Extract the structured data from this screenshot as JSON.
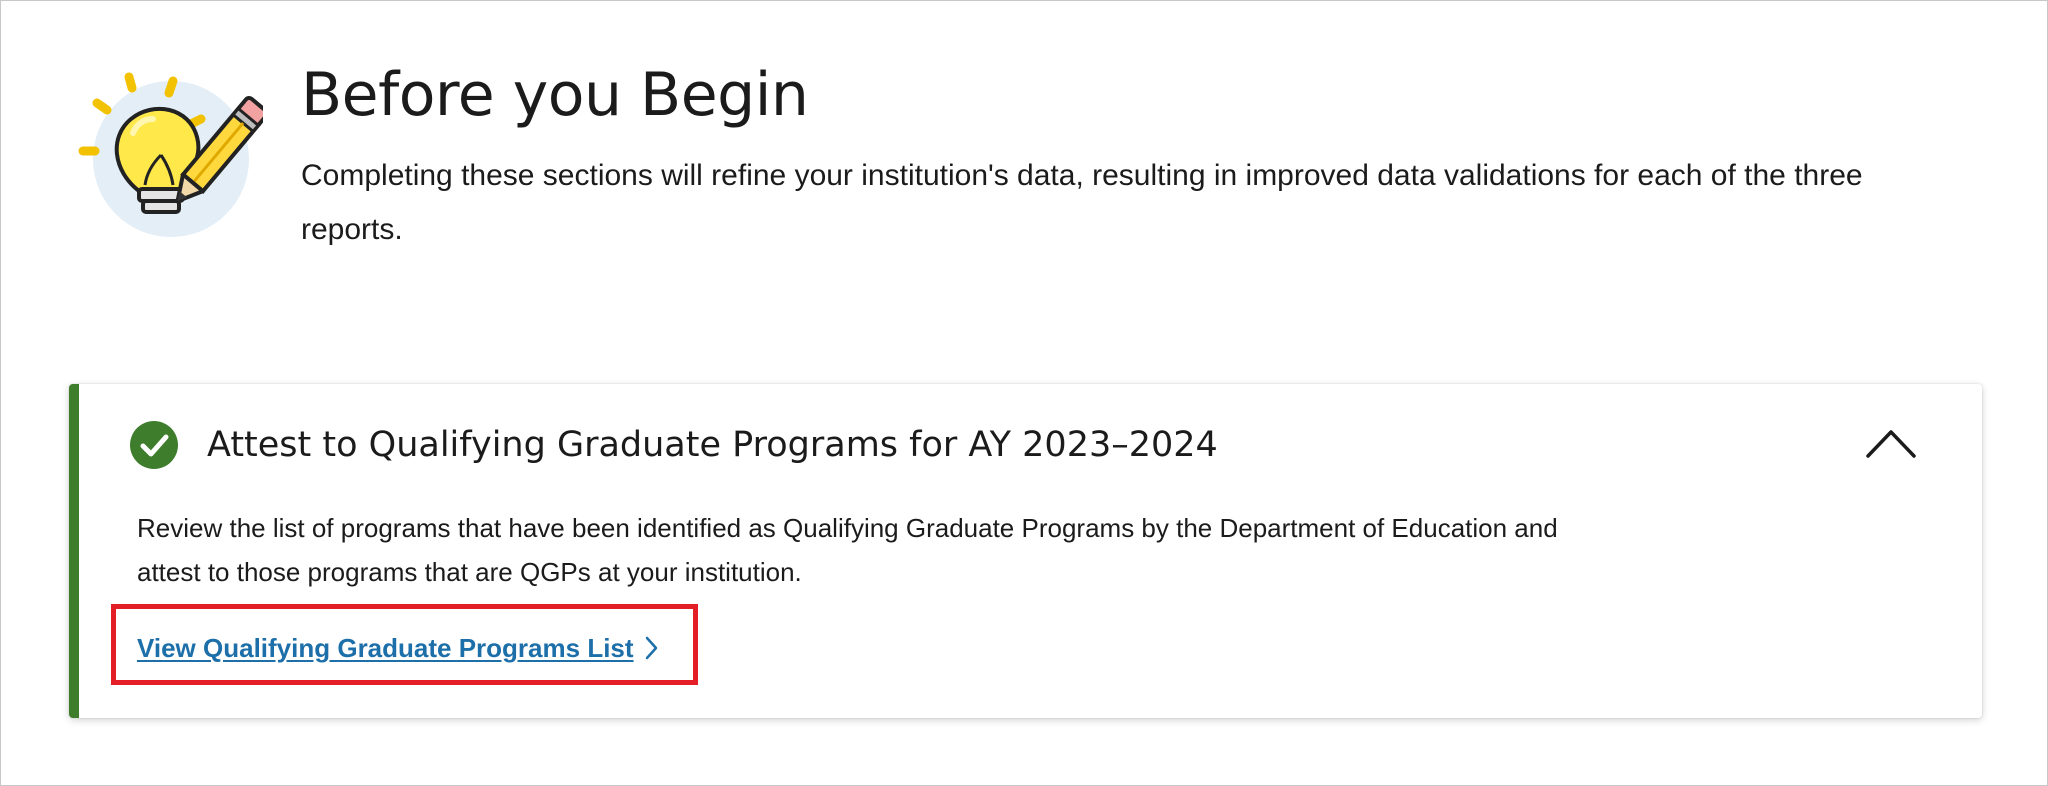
{
  "intro": {
    "title": "Before you Begin",
    "description": "Completing these sections will refine your institution's data, resulting in improved data validations for each of the three reports.",
    "illustration_icon": "lightbulb-pencil-icon"
  },
  "card": {
    "status_icon": "check-circle-icon",
    "title": "Attest to Qualifying Graduate Programs for AY 2023–2024",
    "description": "Review the list of programs that have been identified as Qualifying Graduate Programs by the Department of Education and attest to those programs that are QGPs at your institution.",
    "link_label": "View Qualifying Graduate Programs List",
    "toggle_icon": "chevron-up-icon",
    "link_icon": "chevron-right-icon"
  },
  "colors": {
    "accent_green": "#3d7d2b",
    "link_blue": "#1d6fa9",
    "highlight_red": "#e41e26",
    "text": "#1b1b1b"
  }
}
